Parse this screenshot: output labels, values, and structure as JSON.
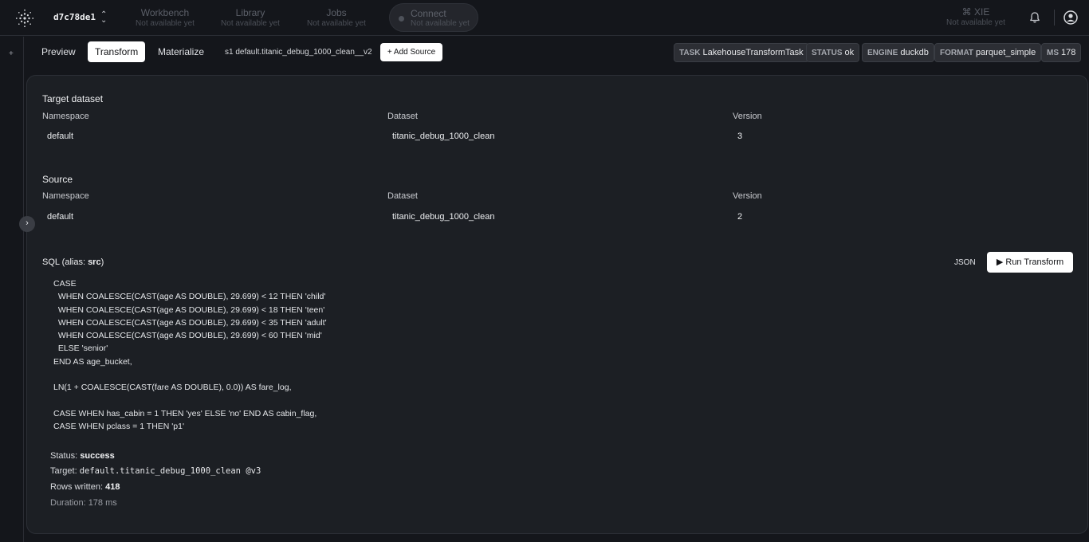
{
  "header": {
    "project_id": "d7c78de1",
    "nav": [
      {
        "title": "Workbench",
        "subtitle": "Not available yet"
      },
      {
        "title": "Library",
        "subtitle": "Not available yet"
      },
      {
        "title": "Jobs",
        "subtitle": "Not available yet"
      }
    ],
    "connect": {
      "title": "Connect",
      "subtitle": "Not available yet"
    },
    "xie": {
      "title": "⌘ XIE",
      "subtitle": "Not available yet"
    }
  },
  "rail": {
    "plus": "+",
    "toggle": "›"
  },
  "tabs": [
    "Preview",
    "Transform",
    "Materialize"
  ],
  "source_chip": "s1 default.titanic_debug_1000_clean__v2",
  "add_source_label": "+ Add Source",
  "badges": [
    {
      "key": "TASK",
      "value": "LakehouseTransformTask"
    },
    {
      "key": "STATUS",
      "value": "ok"
    },
    {
      "key": "ENGINE",
      "value": "duckdb"
    },
    {
      "key": "FORMAT",
      "value": "parquet_simple"
    },
    {
      "key": "MS",
      "value": "178"
    }
  ],
  "target_dataset": {
    "title": "Target dataset",
    "labels": {
      "namespace": "Namespace",
      "dataset": "Dataset",
      "version": "Version"
    },
    "values": {
      "namespace": "default",
      "dataset": "titanic_debug_1000_clean",
      "version": "3"
    }
  },
  "source": {
    "title": "Source",
    "labels": {
      "namespace": "Namespace",
      "dataset": "Dataset",
      "version": "Version"
    },
    "values": {
      "namespace": "default",
      "dataset": "titanic_debug_1000_clean",
      "version": "2"
    }
  },
  "sql": {
    "title_prefix": "SQL (alias: ",
    "alias": "src",
    "title_suffix": ")",
    "json_label": "JSON",
    "run_label": "▶ Run Transform",
    "code": "CASE\n  WHEN COALESCE(CAST(age AS DOUBLE), 29.699) < 12 THEN 'child'\n  WHEN COALESCE(CAST(age AS DOUBLE), 29.699) < 18 THEN 'teen'\n  WHEN COALESCE(CAST(age AS DOUBLE), 29.699) < 35 THEN 'adult'\n  WHEN COALESCE(CAST(age AS DOUBLE), 29.699) < 60 THEN 'mid'\n  ELSE 'senior'\nEND AS age_bucket,\n\nLN(1 + COALESCE(CAST(fare AS DOUBLE), 0.0)) AS fare_log,\n\nCASE WHEN has_cabin = 1 THEN 'yes' ELSE 'no' END AS cabin_flag,\nCASE WHEN pclass = 1 THEN 'p1'"
  },
  "result": {
    "status_label": "Status:",
    "status_value": "success",
    "target_label": "Target:",
    "target_value": "default.titanic_debug_1000_clean @v3",
    "rows_label": "Rows written:",
    "rows_value": "418",
    "duration": "Duration: 178 ms"
  }
}
